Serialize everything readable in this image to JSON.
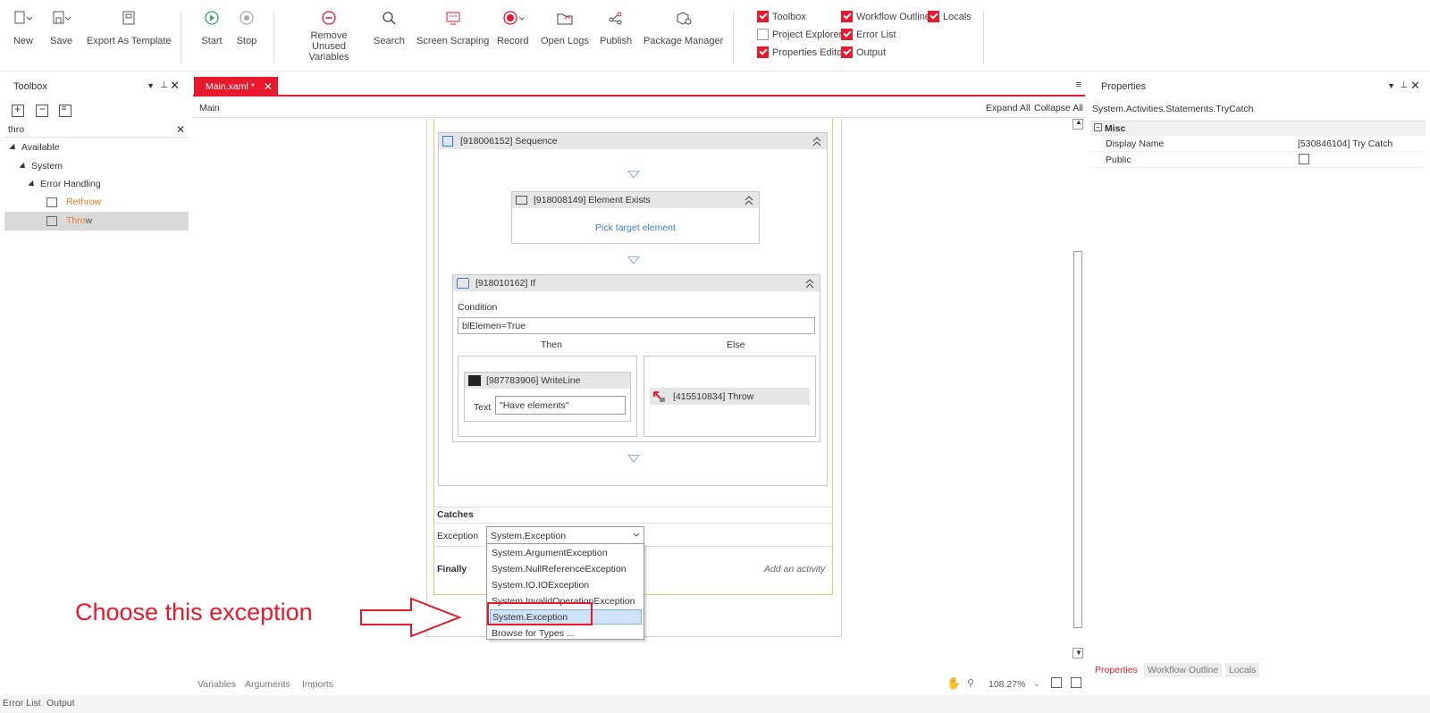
{
  "ribbon": {
    "buttons": [
      {
        "id": "new",
        "label": "New",
        "icon": "new-file-icon"
      },
      {
        "id": "save",
        "label": "Save",
        "icon": "save-icon"
      },
      {
        "id": "export",
        "label": "Export As Template",
        "icon": "export-template-icon"
      },
      {
        "id": "start",
        "label": "Start",
        "icon": "play-icon"
      },
      {
        "id": "stop",
        "label": "Stop",
        "icon": "stop-icon"
      },
      {
        "id": "remove_unused",
        "label": "Remove Unused Variables",
        "icon": "minus-circle-icon"
      },
      {
        "id": "search",
        "label": "Search",
        "icon": "search-icon"
      },
      {
        "id": "screen_scraping",
        "label": "Screen Scraping",
        "icon": "screen-scraping-icon"
      },
      {
        "id": "record",
        "label": "Record",
        "icon": "record-icon"
      },
      {
        "id": "open_logs",
        "label": "Open Logs",
        "icon": "folder-icon"
      },
      {
        "id": "publish",
        "label": "Publish",
        "icon": "share-icon"
      },
      {
        "id": "package_manager",
        "label": "Package Manager",
        "icon": "package-icon"
      }
    ],
    "checks": [
      {
        "label": "Toolbox",
        "checked": true
      },
      {
        "label": "Workflow Outline",
        "checked": true
      },
      {
        "label": "Locals",
        "checked": true
      },
      {
        "label": "Project Explorer",
        "checked": false
      },
      {
        "label": "Error List",
        "checked": true
      },
      {
        "label": "Properties Editor",
        "checked": true
      },
      {
        "label": "Output",
        "checked": true
      }
    ]
  },
  "toolbox": {
    "title": "Toolbox",
    "search_value": "thro",
    "tree": {
      "available": "Available",
      "system": "System",
      "error_handling": "Error Handling",
      "rethrow_pre": "Re",
      "rethrow_match": "throw",
      "throw_match": "Thro",
      "throw_post": "w"
    }
  },
  "tabs": {
    "main_tab": "Main.xaml *"
  },
  "designer": {
    "breadcrumb": "Main",
    "expand_all": "Expand All",
    "collapse_all": "Collapse All",
    "sequence_title": "[918006152] Sequence",
    "element_exists_title": "[918008149] Element Exists",
    "pick_target": "Pick target element",
    "if_title": "[918010162] If",
    "condition_label": "Condition",
    "condition_value": "blElemen=True",
    "then_label": "Then",
    "else_label": "Else",
    "writeline_title": "[987783906] WriteLine",
    "text_label": "Text",
    "text_value": "\"Have elements\"",
    "throw_title": "[415510834] Throw",
    "catches_label": "Catches",
    "exception_label": "Exception",
    "exception_value": "System.Exception",
    "finally_label": "Finally",
    "add_activity": "Add an activity",
    "dropdown_items": [
      "System.ArgumentException",
      "System.NullReferenceException",
      "System.IO.IOException",
      "System.InvalidOperationException",
      "System.Exception",
      "Browse for Types ..."
    ],
    "annotation": "Choose this exception"
  },
  "bottom_tabs": [
    "Variables",
    "Arguments",
    "Imports"
  ],
  "zoom": "108.27%",
  "properties": {
    "title": "Properties",
    "type": "System.Activities.Statements.TryCatch",
    "category": "Misc",
    "display_name_label": "Display Name",
    "display_name_value": "[530846104] Try Catch",
    "public_label": "Public"
  },
  "right_tabs": [
    "Properties",
    "Workflow Outline",
    "Locals"
  ],
  "status_tabs": [
    "Error List",
    "Output"
  ],
  "colors": {
    "accent": "#e8192c",
    "match": "#f07830",
    "link": "#3d7bc4"
  }
}
